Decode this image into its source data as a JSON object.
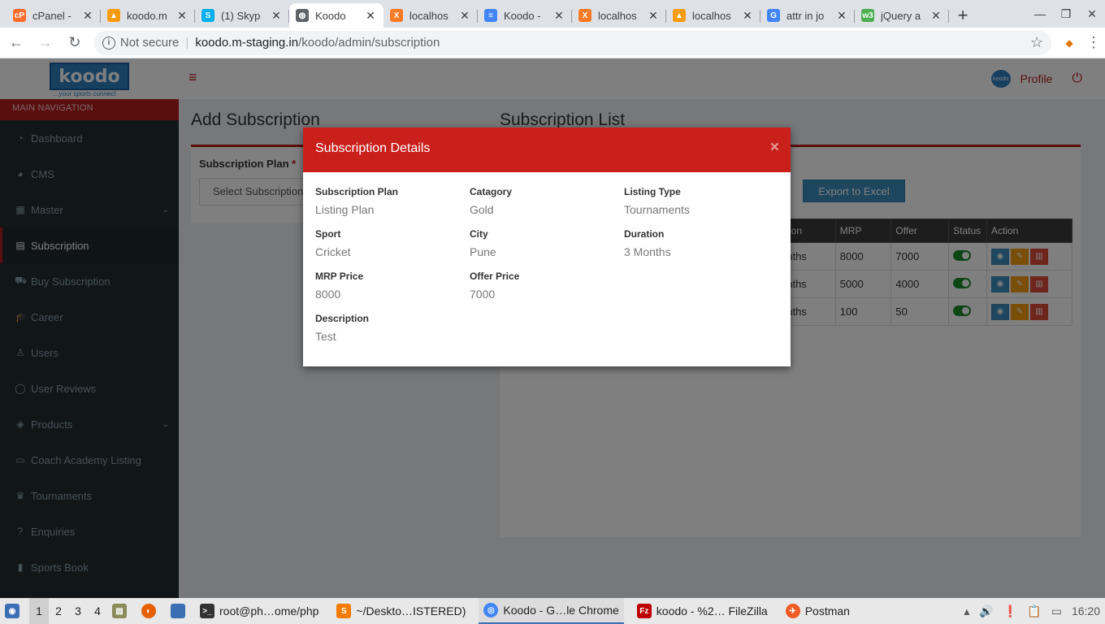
{
  "browser": {
    "tabs": [
      {
        "title": "cPanel -",
        "icon": "cpanel-icon",
        "color": "#ff6c2c",
        "glyph": "cP"
      },
      {
        "title": "koodo.m",
        "icon": "phpmyadmin-icon",
        "color": "#f89c0e",
        "glyph": "▲"
      },
      {
        "title": "(1) Skyp",
        "icon": "skype-icon",
        "color": "#00aff0",
        "glyph": "S"
      },
      {
        "title": "Koodo",
        "icon": "globe-icon",
        "color": "#5f6368",
        "glyph": "◍"
      },
      {
        "title": "localhos",
        "icon": "xampp-icon",
        "color": "#fb7a24",
        "glyph": "X"
      },
      {
        "title": "Koodo -",
        "icon": "docs-icon",
        "color": "#4285f4",
        "glyph": "≡"
      },
      {
        "title": "localhos",
        "icon": "xampp-icon",
        "color": "#fb7a24",
        "glyph": "X"
      },
      {
        "title": "localhos",
        "icon": "phpmyadmin-icon",
        "color": "#f89c0e",
        "glyph": "▲"
      },
      {
        "title": "attr in jo",
        "icon": "google-icon",
        "color": "#4285f4",
        "glyph": "G"
      },
      {
        "title": "jQuery a",
        "icon": "w3schools-icon",
        "color": "#4caf50",
        "glyph": "w3"
      }
    ],
    "active_tab": 3,
    "not_secure": "Not secure",
    "url_host": "koodo.m-staging.in",
    "url_path": "/koodo/admin/subscription"
  },
  "app": {
    "logo_text": "koodo",
    "logo_tagline": "...your sports connect",
    "profile_label": "Profile",
    "nav_header": "MAIN NAVIGATION",
    "nav_items": [
      {
        "label": "Dashboard",
        "icon": "dashboard-icon",
        "glyph": "◔"
      },
      {
        "label": "CMS",
        "icon": "pie-chart-icon",
        "glyph": "◕"
      },
      {
        "label": "Master",
        "icon": "table-icon",
        "glyph": "▦",
        "has_chevron": true
      },
      {
        "label": "Subscription",
        "icon": "id-card-icon",
        "glyph": "▤",
        "active": true
      },
      {
        "label": "Buy Subscription",
        "icon": "cart-icon",
        "glyph": "⛟"
      },
      {
        "label": "Career",
        "icon": "graduation-cap-icon",
        "glyph": "🎓"
      },
      {
        "label": "Users",
        "icon": "user-icon",
        "glyph": "♙"
      },
      {
        "label": "User Reviews",
        "icon": "comment-icon",
        "glyph": "◯"
      },
      {
        "label": "Products",
        "icon": "cube-icon",
        "glyph": "◈",
        "has_chevron": true
      },
      {
        "label": "Coach Academy Listing",
        "icon": "folder-icon",
        "glyph": "▭"
      },
      {
        "label": "Tournaments",
        "icon": "trophy-icon",
        "glyph": "♛"
      },
      {
        "label": "Enquiries",
        "icon": "question-circle-icon",
        "glyph": "?"
      },
      {
        "label": "Sports Book",
        "icon": "book-icon",
        "glyph": "▮"
      }
    ],
    "add_title": "Add Subscription",
    "list_title": "Subscription List",
    "plan_label": "Subscription Plan",
    "plan_select": "Select Subscription",
    "export_label": "Export to Excel",
    "table": {
      "headers": [
        "ation",
        "MRP",
        "Offer",
        "Status",
        "Action"
      ],
      "rows": [
        {
          "duration": "onths",
          "mrp": "8000",
          "offer": "7000"
        },
        {
          "duration": "onths",
          "mrp": "5000",
          "offer": "4000"
        },
        {
          "duration": "onths",
          "mrp": "100",
          "offer": "50"
        }
      ]
    }
  },
  "modal": {
    "title": "Subscription Details",
    "close": "×",
    "fields": {
      "plan": {
        "label": "Subscription Plan",
        "value": "Listing Plan"
      },
      "category": {
        "label": "Catagory",
        "value": "Gold"
      },
      "listing_type": {
        "label": "Listing Type",
        "value": "Tournaments"
      },
      "sport": {
        "label": "Sport",
        "value": "Cricket"
      },
      "city": {
        "label": "City",
        "value": "Pune"
      },
      "duration": {
        "label": "Duration",
        "value": "3 Months"
      },
      "mrp_price": {
        "label": "MRP Price",
        "value": "8000"
      },
      "offer_price": {
        "label": "Offer Price",
        "value": "7000"
      },
      "description": {
        "label": "Description",
        "value": "Test"
      }
    }
  },
  "taskbar": {
    "workspaces": [
      "1",
      "2",
      "3",
      "4"
    ],
    "windows": [
      {
        "label": "root@ph…ome/php",
        "icon": "terminal-icon"
      },
      {
        "label": "~/Deskto…ISTERED)",
        "icon": "sublime-icon"
      },
      {
        "label": "Koodo - G…le Chrome",
        "icon": "chrome-icon",
        "active": true
      },
      {
        "label": "koodo - %2… FileZilla",
        "icon": "filezilla-icon"
      },
      {
        "label": "Postman",
        "icon": "postman-icon"
      }
    ],
    "clock": "16:20"
  }
}
